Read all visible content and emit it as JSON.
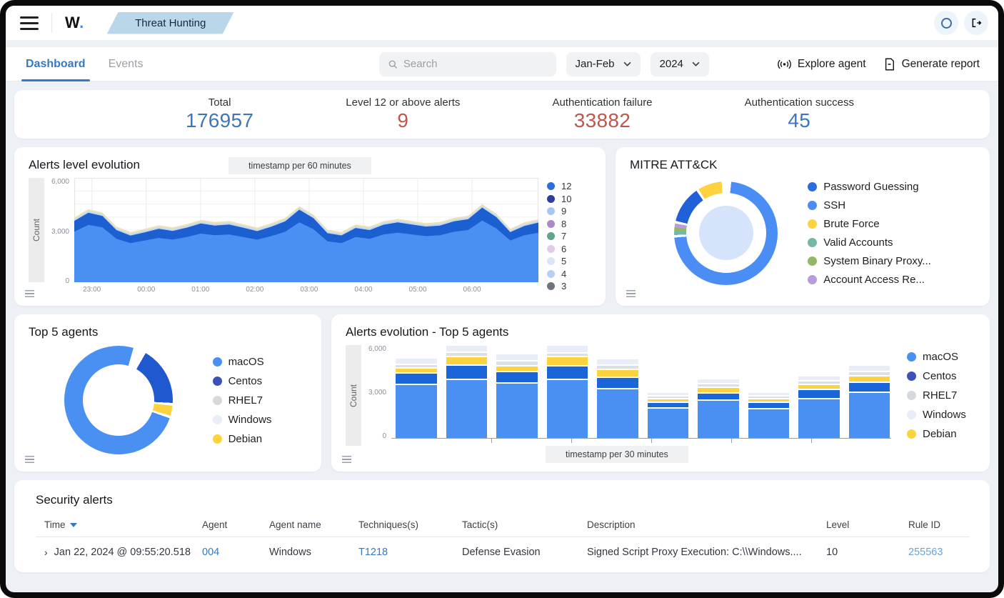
{
  "topbar": {
    "logo_text": "W",
    "logo_dot": ".",
    "breadcrumb": "Threat Hunting"
  },
  "toolbar": {
    "tabs": [
      {
        "label": "Dashboard",
        "active": true
      },
      {
        "label": "Events",
        "active": false
      }
    ],
    "search_placeholder": "Search",
    "month_filter": "Jan-Feb",
    "year_filter": "2024",
    "explore_agent_label": "Explore agent",
    "generate_report_label": "Generate report"
  },
  "stats": [
    {
      "label": "Total",
      "value": "176957",
      "color": "#3d76bd"
    },
    {
      "label": "Level 12 or above alerts",
      "value": "9",
      "color": "#c0564b"
    },
    {
      "label": "Authentication failure",
      "value": "33882",
      "color": "#c0564b"
    },
    {
      "label": "Authentication success",
      "value": "45",
      "color": "#3d76bd"
    }
  ],
  "chart_data": [
    {
      "id": "alerts_level_evolution",
      "type": "area",
      "title": "Alerts level evolution",
      "badge": "timestamp per 60 minutes",
      "ylabel": "Count",
      "ylim": [
        0,
        6000
      ],
      "yticks": [
        "6,000",
        "3,000",
        "0"
      ],
      "xticklabels": [
        "23:00",
        "00:00",
        "01:00",
        "02:00",
        "03:00",
        "04:00",
        "05:00",
        "06:00"
      ],
      "grid": true,
      "legend_position": "right",
      "legend": [
        {
          "label": "12",
          "color": "#2e6fd9"
        },
        {
          "label": "10",
          "color": "#2d3f9c"
        },
        {
          "label": "9",
          "color": "#a8c7f0"
        },
        {
          "label": "8",
          "color": "#a98cc4"
        },
        {
          "label": "7",
          "color": "#63a389"
        },
        {
          "label": "6",
          "color": "#e0cbe8"
        },
        {
          "label": "5",
          "color": "#d8e6f8"
        },
        {
          "label": "4",
          "color": "#b5d0f2"
        },
        {
          "label": "3",
          "color": "#70757d"
        }
      ],
      "series": [
        {
          "name": "12",
          "color": "#4a90f2",
          "values": [
            2900,
            3300,
            3150,
            2500,
            2250,
            2400,
            2550,
            2450,
            2600,
            2800,
            2700,
            2750,
            2600,
            2450,
            2650,
            2900,
            3450,
            3050,
            2350,
            2250,
            2600,
            2500,
            2750,
            2850,
            2750,
            2650,
            2700,
            2900,
            3000,
            3550,
            3100,
            2400,
            2700,
            2850
          ]
        },
        {
          "name": "10",
          "color": "#1b5fd0",
          "values": [
            620,
            700,
            660,
            500,
            430,
            470,
            520,
            500,
            540,
            580,
            560,
            570,
            540,
            490,
            540,
            600,
            720,
            640,
            470,
            440,
            520,
            500,
            560,
            590,
            570,
            550,
            560,
            600,
            620,
            740,
            650,
            480,
            540,
            580
          ]
        },
        {
          "name": "9",
          "color": "#c3d8f7",
          "values": [
            90,
            90,
            90,
            90,
            90,
            90,
            90,
            90,
            90,
            90,
            90,
            90,
            90,
            90,
            90,
            90,
            90,
            90,
            90,
            90,
            90,
            90,
            90,
            90,
            90,
            90,
            90,
            90,
            90,
            90,
            90,
            90,
            90,
            90
          ]
        },
        {
          "name": "8",
          "color": "#e9e0bd",
          "values": [
            110,
            110,
            110,
            110,
            110,
            110,
            110,
            110,
            110,
            110,
            110,
            110,
            110,
            110,
            110,
            110,
            110,
            110,
            110,
            110,
            110,
            110,
            110,
            110,
            110,
            110,
            110,
            110,
            110,
            110,
            110,
            110,
            110,
            110
          ]
        }
      ]
    },
    {
      "id": "mitre_attack",
      "type": "donut",
      "title": "MITRE ATT&CK",
      "size": 145,
      "hole": 112,
      "rotation": 6,
      "inner": {
        "size": 76,
        "color": "#d5e4fb"
      },
      "legend": [
        {
          "label": "Password Guessing",
          "color": "#2b6de0"
        },
        {
          "label": "SSH",
          "color": "#4a8df5"
        },
        {
          "label": "Brute Force",
          "color": "#fdd23f"
        },
        {
          "label": "Valid Accounts",
          "color": "#74b8a8"
        },
        {
          "label": "System Binary Proxy...",
          "color": "#93b865"
        },
        {
          "label": "Account Access Re...",
          "color": "#b79de0"
        }
      ],
      "arcs": [
        {
          "label": "SSH",
          "color": "#4a8df5",
          "pct": 72
        },
        {
          "label": "",
          "color": "#ffffff",
          "pct": 0.8
        },
        {
          "label": "Valid Accounts",
          "color": "#74b8a8",
          "pct": 1.2
        },
        {
          "label": "System Binary Proxy...",
          "color": "#93b865",
          "pct": 1.2
        },
        {
          "label": "Account Access Re...",
          "color": "#b79de0",
          "pct": 1.2
        },
        {
          "label": "",
          "color": "#ffffff",
          "pct": 0.8
        },
        {
          "label": "Password Guessing",
          "color": "#2060d8",
          "pct": 11.5
        },
        {
          "label": "",
          "color": "#ffffff",
          "pct": 0.8
        },
        {
          "label": "Brute Force",
          "color": "#fdd23f",
          "pct": 7.5
        },
        {
          "label": "",
          "color": "#ffffff",
          "pct": 3
        }
      ]
    },
    {
      "id": "top5_agents",
      "type": "donut",
      "title": "Top 5 agents",
      "size": 152,
      "hole": 100,
      "rotation": 30,
      "inner": null,
      "legend": [
        {
          "label": "macOS",
          "color": "#4a90f2"
        },
        {
          "label": "Centos",
          "color": "#3d51b5"
        },
        {
          "label": "RHEL7",
          "color": "#d5d9dd"
        },
        {
          "label": "Windows",
          "color": "#e9edf8"
        },
        {
          "label": "Debian",
          "color": "#fdd23f"
        }
      ],
      "arcs": [
        {
          "label": "Centos",
          "color": "#2058cf",
          "pct": 17.5
        },
        {
          "label": "",
          "color": "#ffffff",
          "pct": 0.8
        },
        {
          "label": "Debian",
          "color": "#fdd23f",
          "pct": 3
        },
        {
          "label": "",
          "color": "#ffffff",
          "pct": 0.8
        },
        {
          "label": "macOS",
          "color": "#4a90f2",
          "pct": 74
        },
        {
          "label": "",
          "color": "#ffffff",
          "pct": 3.9
        }
      ]
    },
    {
      "id": "alerts_evolution_top5",
      "type": "bar",
      "title": "Alerts evolution - Top 5 agents",
      "badge": "timestamp per 30 minutes",
      "ylabel": "Count",
      "ylim": [
        0,
        6000
      ],
      "yticks": [
        "6,000",
        "3,000",
        "0"
      ],
      "categories": [
        "",
        "",
        "",
        "",
        "",
        "",
        "",
        "",
        "",
        ""
      ],
      "legend_position": "right",
      "legend": [
        {
          "label": "macOS",
          "color": "#4a90f2"
        },
        {
          "label": "Centos",
          "color": "#3d51b5"
        },
        {
          "label": "RHEL7",
          "color": "#d5d9dd"
        },
        {
          "label": "Windows",
          "color": "#e9edf8"
        },
        {
          "label": "Debian",
          "color": "#fdd23f"
        }
      ],
      "series": [
        {
          "name": "macOS",
          "color": "#4a90f2",
          "values": [
            3400,
            3750,
            3500,
            3750,
            3150,
            1900,
            2400,
            1850,
            2500,
            2900
          ]
        },
        {
          "name": "Centos",
          "color": "#1a66d9",
          "values": [
            650,
            800,
            650,
            780,
            650,
            250,
            380,
            300,
            500,
            560
          ]
        },
        {
          "name": "Debian",
          "color": "#fdd23f",
          "values": [
            250,
            480,
            300,
            480,
            420,
            160,
            260,
            160,
            220,
            320
          ]
        },
        {
          "name": "RHEL7",
          "color": "#dcdfe3",
          "values": [
            150,
            180,
            200,
            180,
            150,
            90,
            130,
            90,
            140,
            180
          ]
        },
        {
          "name": "Windows",
          "color": "#e9edf7",
          "values": [
            300,
            380,
            400,
            380,
            330,
            150,
            230,
            150,
            240,
            340
          ]
        }
      ]
    }
  ],
  "table": {
    "title": "Security alerts",
    "columns": [
      {
        "label": "Time",
        "sortable": true
      },
      {
        "label": "Agent",
        "sortable": false
      },
      {
        "label": "Agent name",
        "sortable": false
      },
      {
        "label": "Techniques(s)",
        "sortable": false
      },
      {
        "label": "Tactic(s)",
        "sortable": false
      },
      {
        "label": "Description",
        "sortable": false
      },
      {
        "label": "Level",
        "sortable": false
      },
      {
        "label": "Rule ID",
        "sortable": false
      }
    ],
    "rows": [
      {
        "cells": [
          {
            "text": "Jan 22, 2024 @ 09:55:20.518",
            "style": "expand"
          },
          {
            "text": "004",
            "style": "link"
          },
          {
            "text": "Windows",
            "style": "plain"
          },
          {
            "text": "T1218",
            "style": "link"
          },
          {
            "text": "Defense Evasion",
            "style": "plain"
          },
          {
            "text": "Signed Script Proxy Execution: C:\\\\Windows....",
            "style": "plain"
          },
          {
            "text": "10",
            "style": "plain"
          },
          {
            "text": "255563",
            "style": "link_light"
          }
        ]
      }
    ]
  }
}
